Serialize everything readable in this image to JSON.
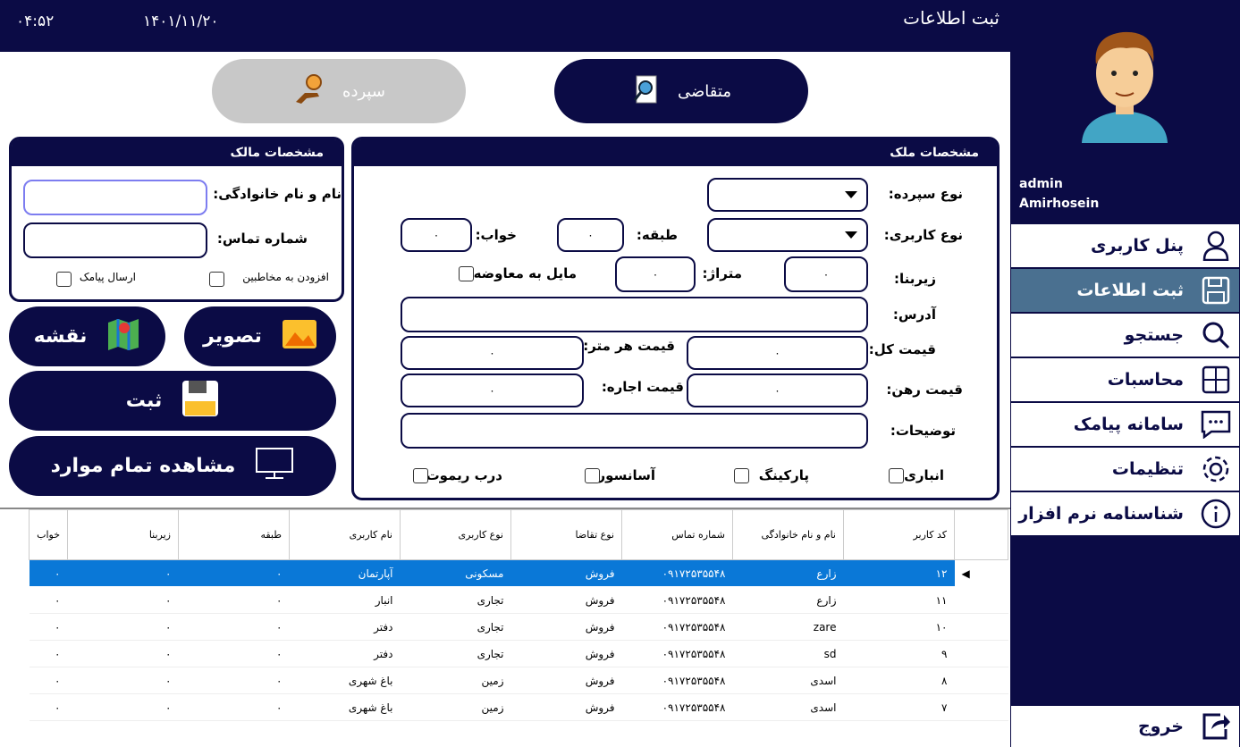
{
  "header": {
    "clock": "۰۴:۵۲",
    "date": "۱۴۰۱/۱۱/۲۰",
    "title": "ثبت اطلاعات"
  },
  "tabs": {
    "applicant": "متقاضی",
    "deposit": "سپرده"
  },
  "owner": {
    "title": "مشخصات مالک",
    "name_label": "نام و نام خانوادگی:",
    "phone_label": "شماره تماس:",
    "add_contacts": "افزودن به مخاطبین",
    "send_sms": "ارسال پیامک"
  },
  "property": {
    "title": "مشخصات ملک",
    "deposit_type_label": "نوع سپرده:",
    "usage_type_label": "نوع کاربری:",
    "floor_label": "طبقه:",
    "bed_label": "خواب:",
    "floor_value": "۰",
    "bed_value": "۰",
    "infra_label": "زیربنا:",
    "meter_label": "متراژ:",
    "infra_value": "۰",
    "meter_value": "۰",
    "exchange_label": "مایل به معاوضه",
    "address_label": "آدرس:",
    "total_price_label": "قیمت کل:",
    "price_per_meter_label": "قیمت هر متر:",
    "total_price_value": "۰",
    "price_per_meter_value": "۰",
    "mortgage_label": "قیمت رهن:",
    "rent_label": "قیمت اجاره:",
    "mortgage_value": "۰",
    "rent_value": "۰",
    "desc_label": "توضیحات:",
    "storage": "انباری",
    "parking": "پارکینگ",
    "elevator": "آسانسور",
    "remote_door": "درب ریموت"
  },
  "buttons": {
    "image": "تصویر",
    "map": "نقشه",
    "save": "ثبت",
    "view_all": "مشاهده تمام موارد"
  },
  "user": {
    "role": "admin",
    "name": "Amirhosein"
  },
  "sidebar": {
    "items": [
      {
        "label": "پنل کاربری",
        "icon": "user-icon"
      },
      {
        "label": "ثبت اطلاعات",
        "icon": "save-icon"
      },
      {
        "label": "جستجو",
        "icon": "search-icon"
      },
      {
        "label": "محاسبات",
        "icon": "calculator-icon"
      },
      {
        "label": "سامانه پیامک",
        "icon": "message-icon"
      },
      {
        "label": "تنظیمات",
        "icon": "gear-icon"
      },
      {
        "label": "شناسنامه نرم افزار",
        "icon": "info-icon"
      }
    ],
    "exit": "خروج"
  },
  "table": {
    "columns": [
      "کد کاربر",
      "نام و نام خانوادگی",
      "شماره تماس",
      "نوع تقاضا",
      "نوع کاربری",
      "نام کاربری",
      "طبقه",
      "زیربنا",
      "خواب"
    ],
    "rows": [
      [
        "۱۲",
        "زارع",
        "۰۹۱۷۲۵۳۵۵۴۸",
        "فروش",
        "مسکونی",
        "آپارتمان",
        "۰",
        "۰",
        "۰"
      ],
      [
        "۱۱",
        "زارع",
        "۰۹۱۷۲۵۳۵۵۴۸",
        "فروش",
        "تجاری",
        "انبار",
        "۰",
        "۰",
        "۰"
      ],
      [
        "۱۰",
        "zare",
        "۰۹۱۷۲۵۳۵۵۴۸",
        "فروش",
        "تجاری",
        "دفتر",
        "۰",
        "۰",
        "۰"
      ],
      [
        "۹",
        "sd",
        "۰۹۱۷۲۵۳۵۵۴۸",
        "فروش",
        "تجاری",
        "دفتر",
        "۰",
        "۰",
        "۰"
      ],
      [
        "۸",
        "اسدی",
        "۰۹۱۷۲۵۳۵۵۴۸",
        "فروش",
        "زمین",
        "باغ شهری",
        "۰",
        "۰",
        "۰"
      ],
      [
        "۷",
        "اسدی",
        "۰۹۱۷۲۵۳۵۵۴۸",
        "فروش",
        "زمین",
        "باغ شهری",
        "۰",
        "۰",
        "۰"
      ]
    ]
  }
}
